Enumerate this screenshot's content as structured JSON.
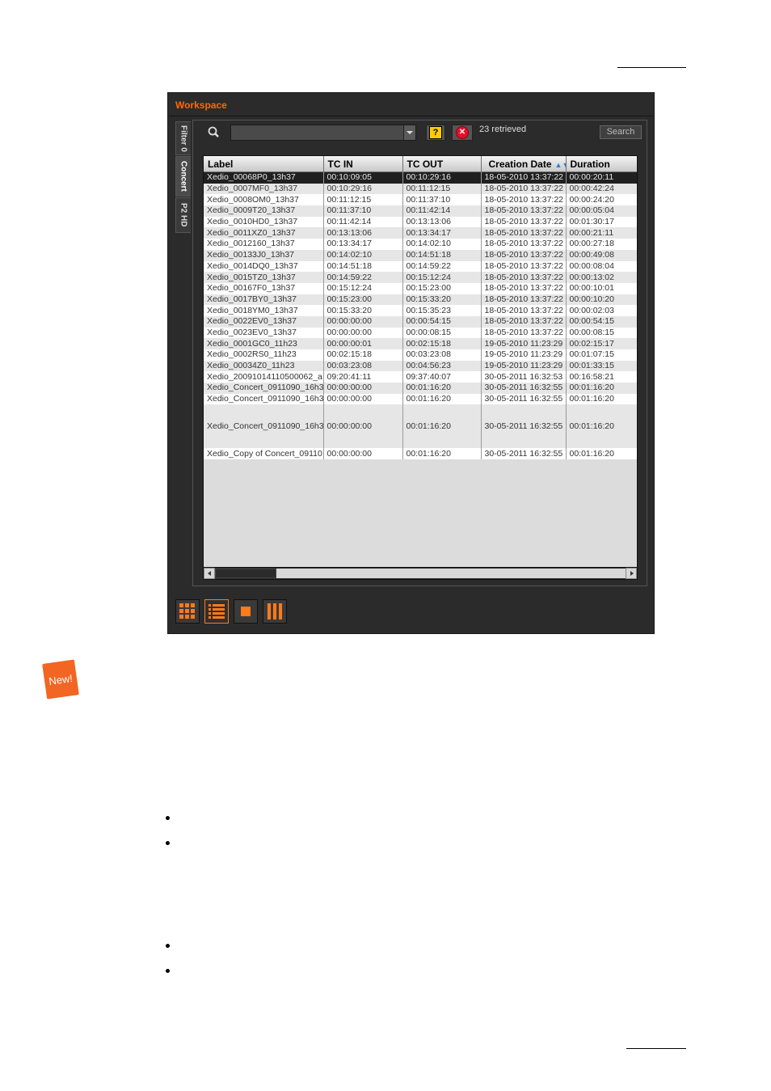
{
  "window": {
    "title": "Workspace"
  },
  "tabs": [
    {
      "label": "Filter 0"
    },
    {
      "label": "Concert"
    },
    {
      "label": "P2 HD"
    }
  ],
  "search": {
    "value": "",
    "placeholder": "",
    "retrieved": "23 retrieved",
    "button_label": "Search",
    "help_icon_text": "?",
    "clear_icon_text": "✕"
  },
  "table": {
    "columns": [
      "Label",
      "TC IN",
      "TC OUT",
      "Creation Date",
      "Duration"
    ],
    "sort_indicator": "▲▼",
    "rows": [
      [
        "Xedio_00068P0_13h37",
        "00:10:09:05",
        "00:10:29:16",
        "18-05-2010 13:37:22",
        "00:00:20:11"
      ],
      [
        "Xedio_0007MF0_13h37",
        "00:10:29:16",
        "00:11:12:15",
        "18-05-2010 13:37:22",
        "00:00:42:24"
      ],
      [
        "Xedio_0008OM0_13h37",
        "00:11:12:15",
        "00:11:37:10",
        "18-05-2010 13:37:22",
        "00:00:24:20"
      ],
      [
        "Xedio_0009T20_13h37",
        "00:11:37:10",
        "00:11:42:14",
        "18-05-2010 13:37:22",
        "00:00:05:04"
      ],
      [
        "Xedio_0010HD0_13h37",
        "00:11:42:14",
        "00:13:13:06",
        "18-05-2010 13:37:22",
        "00:01:30:17"
      ],
      [
        "Xedio_0011XZ0_13h37",
        "00:13:13:06",
        "00:13:34:17",
        "18-05-2010 13:37:22",
        "00:00:21:11"
      ],
      [
        "Xedio_0012160_13h37",
        "00:13:34:17",
        "00:14:02:10",
        "18-05-2010 13:37:22",
        "00:00:27:18"
      ],
      [
        "Xedio_00133J0_13h37",
        "00:14:02:10",
        "00:14:51:18",
        "18-05-2010 13:37:22",
        "00:00:49:08"
      ],
      [
        "Xedio_0014DQ0_13h37",
        "00:14:51:18",
        "00:14:59:22",
        "18-05-2010 13:37:22",
        "00:00:08:04"
      ],
      [
        "Xedio_0015TZ0_13h37",
        "00:14:59:22",
        "00:15:12:24",
        "18-05-2010 13:37:22",
        "00:00:13:02"
      ],
      [
        "Xedio_00167F0_13h37",
        "00:15:12:24",
        "00:15:23:00",
        "18-05-2010 13:37:22",
        "00:00:10:01"
      ],
      [
        "Xedio_0017BY0_13h37",
        "00:15:23:00",
        "00:15:33:20",
        "18-05-2010 13:37:22",
        "00:00:10:20"
      ],
      [
        "Xedio_0018YM0_13h37",
        "00:15:33:20",
        "00:15:35:23",
        "18-05-2010 13:37:22",
        "00:00:02:03"
      ],
      [
        "Xedio_0022EV0_13h37",
        "00:00:00:00",
        "00:00:54:15",
        "18-05-2010 13:37:22",
        "00:00:54:15"
      ],
      [
        "Xedio_0023EV0_13h37",
        "00:00:00:00",
        "00:00:08:15",
        "18-05-2010 13:37:22",
        "00:00:08:15"
      ],
      [
        "Xedio_0001GC0_11h23",
        "00:00:00:01",
        "00:02:15:18",
        "19-05-2010 11:23:29",
        "00:02:15:17"
      ],
      [
        "Xedio_0002RS0_11h23",
        "00:02:15:18",
        "00:03:23:08",
        "19-05-2010 11:23:29",
        "00:01:07:15"
      ],
      [
        "Xedio_00034Z0_11h23",
        "00:03:23:08",
        "00:04:56:23",
        "19-05-2010 11:23:29",
        "00:01:33:15"
      ],
      [
        "Xedio_20091014110500062_a",
        "09:20:41:11",
        "09:37:40:07",
        "30-05-2011 16:32:53",
        "00:16:58:21"
      ],
      [
        "Xedio_Concert_0911090_16h3",
        "00:00:00:00",
        "00:01:16:20",
        "30-05-2011 16:32:55",
        "00:01:16:20"
      ],
      [
        "Xedio_Concert_0911090_16h3",
        "00:00:00:00",
        "00:01:16:20",
        "30-05-2011 16:32:55",
        "00:01:16:20"
      ],
      [
        "Xedio_Concert_0911090_16h3",
        "00:00:00:00",
        "00:01:16:20",
        "30-05-2011 16:32:55",
        "00:01:16:20"
      ],
      [
        "Xedio_Copy of Concert_09110",
        "00:00:00:00",
        "00:01:16:20",
        "30-05-2011 16:32:55",
        "00:01:16:20"
      ]
    ]
  },
  "badge": {
    "text": "New!"
  },
  "colors": {
    "accent": "#ff6a00",
    "window_bg": "#2b2b2b",
    "selected_row": "#202020"
  },
  "icons": [
    "search-icon",
    "help-icon",
    "clear-icon",
    "grid-view-icon",
    "list-view-icon",
    "single-view-icon",
    "columns-view-icon"
  ]
}
